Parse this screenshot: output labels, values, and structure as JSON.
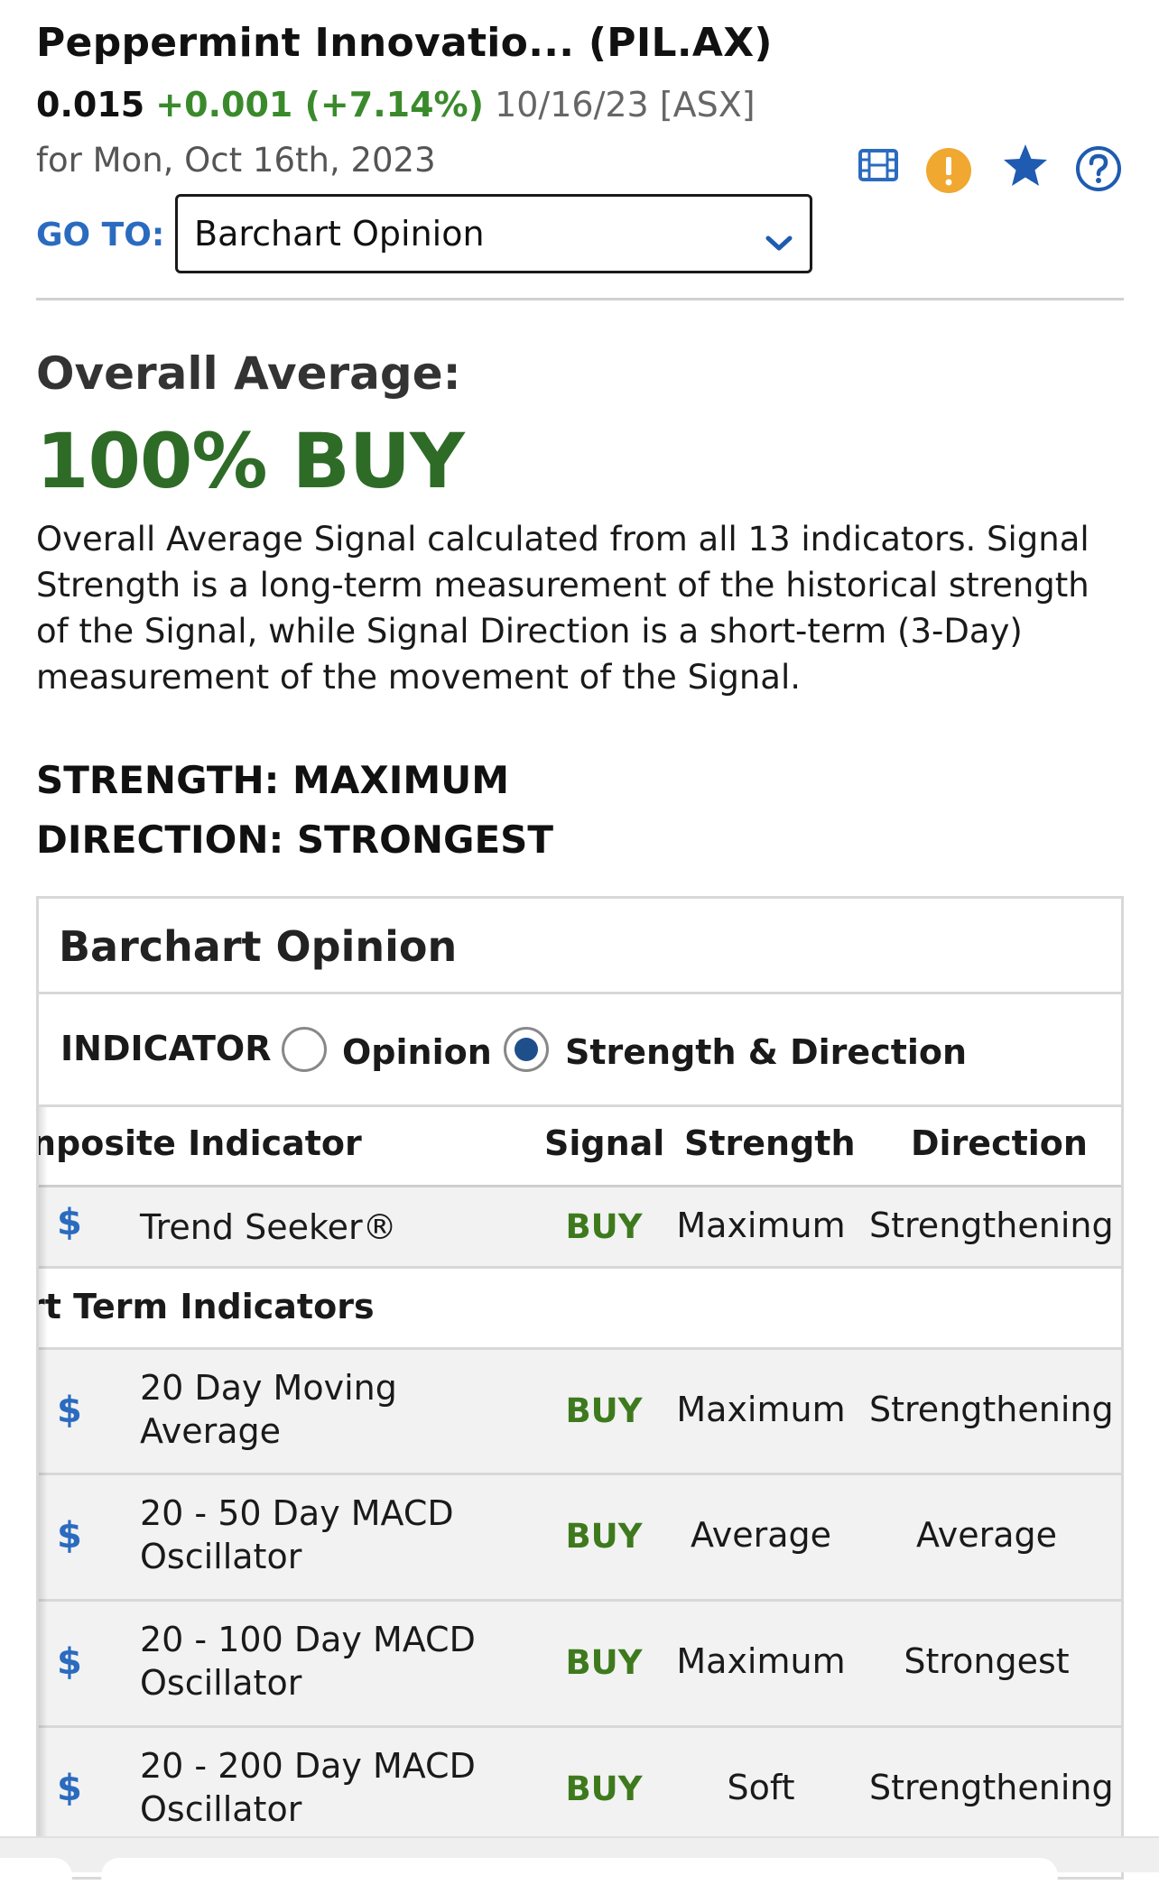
{
  "header": {
    "title": "Peppermint Innovatio...  (PIL.AX)",
    "price": "0.015",
    "change": "+0.001 (+7.14%)",
    "date_exchange": "10/16/23 [ASX]",
    "for_date": "for Mon, Oct 16th, 2023",
    "icons": [
      "film-icon",
      "alert-icon",
      "star-icon",
      "help-icon"
    ]
  },
  "goto": {
    "label": "GO TO:",
    "selected": "Barchart Opinion"
  },
  "overall": {
    "label": "Overall Average:",
    "value": "100% BUY",
    "description": "Overall Average Signal calculated from all 13 indicators. Signal Strength is a long-term measurement of the historical strength of the Signal, while Signal Direction is a short-term (3-Day) measurement of the movement of the Signal.",
    "strength": "STRENGTH: MAXIMUM",
    "direction": "DIRECTION: STRONGEST"
  },
  "panel": {
    "title": "Barchart Opinion",
    "indicator_label": "INDICATOR",
    "options": [
      "Opinion",
      "Strength & Direction"
    ],
    "selected_option": "Strength & Direction"
  },
  "table": {
    "headers": {
      "indicator": "nposite Indicator",
      "signal": "Signal",
      "strength": "Strength",
      "direction": "Direction"
    },
    "composite_rows": [
      {
        "name": "Trend Seeker®",
        "signal": "BUY",
        "strength": "Maximum",
        "direction": "Strengthening"
      }
    ],
    "short_term_section": "rt Term Indicators",
    "short_term_rows": [
      {
        "name": "20 Day Moving Average",
        "signal": "BUY",
        "strength": "Maximum",
        "direction": "Strengthening"
      },
      {
        "name": "20 - 50 Day MACD Oscillator",
        "signal": "BUY",
        "strength": "Average",
        "direction": "Average"
      },
      {
        "name": "20 - 100 Day MACD Oscillator",
        "signal": "BUY",
        "strength": "Maximum",
        "direction": "Strongest"
      },
      {
        "name": "20 - 200 Day MACD Oscillator",
        "signal": "BUY",
        "strength": "Soft",
        "direction": "Strengthening"
      }
    ],
    "dollar_symbol": "$"
  },
  "colors": {
    "positive": "#3a8a2c",
    "buy": "#3e7a1d",
    "overall_buy": "#2e6b27",
    "link_blue": "#2b6bbf",
    "alert_orange": "#f0a830"
  }
}
